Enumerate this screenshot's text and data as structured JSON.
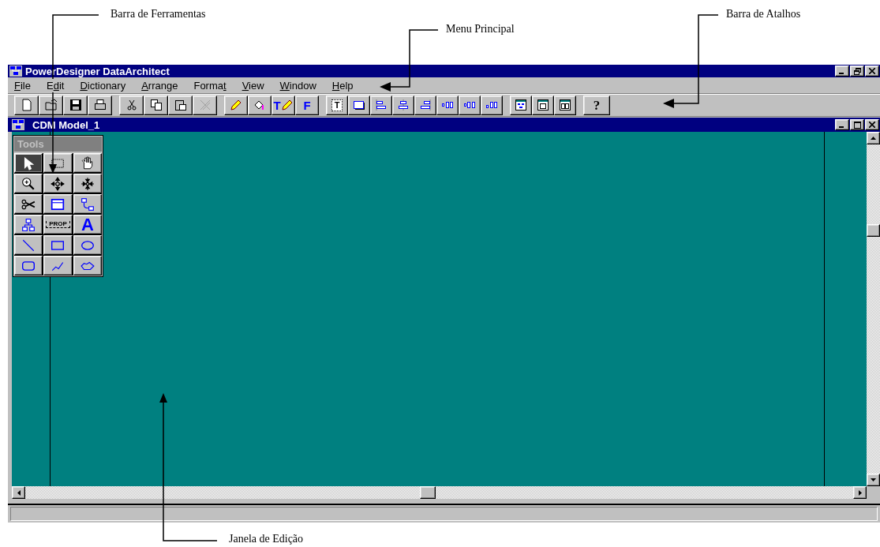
{
  "annotations": [
    {
      "text": "Barra de Ferramentas"
    },
    {
      "text": "Menu Principal"
    },
    {
      "text": "Barra de Atalhos"
    },
    {
      "text": "Janela de Edição"
    }
  ],
  "window": {
    "title": "PowerDesigner DataArchitect"
  },
  "menu": [
    {
      "key": "F",
      "rest": "ile"
    },
    {
      "before": "E",
      "key": "d",
      "rest": "it"
    },
    {
      "key": "D",
      "rest": "ictionary"
    },
    {
      "key": "A",
      "rest": "rrange"
    },
    {
      "before": "Forma",
      "key": "t"
    },
    {
      "key": "V",
      "rest": "iew"
    },
    {
      "key": "W",
      "rest": "indow"
    },
    {
      "key": "H",
      "rest": "elp"
    }
  ],
  "toolbar": [
    [
      {
        "disabled": false
      },
      {
        "disabled": false
      },
      {
        "disabled": false
      },
      {
        "disabled": false
      }
    ],
    [
      {
        "disabled": false
      },
      {
        "disabled": false
      },
      {
        "disabled": false
      },
      {
        "disabled": true
      }
    ],
    [
      {
        "disabled": false
      },
      {
        "disabled": false
      },
      {
        "disabled": false,
        "label": "T"
      },
      {
        "disabled": false,
        "label": "F"
      }
    ],
    [
      {
        "disabled": false,
        "label": "T"
      },
      {
        "disabled": false
      },
      {
        "disabled": false
      },
      {
        "disabled": false
      },
      {
        "disabled": false
      },
      {
        "disabled": false
      },
      {
        "disabled": false
      },
      {
        "disabled": false
      }
    ],
    [
      {
        "disabled": false
      },
      {
        "disabled": false
      },
      {
        "disabled": false
      }
    ],
    [
      {
        "disabled": false,
        "label": "?"
      }
    ]
  ],
  "document": {
    "title": "CDM Model_1"
  },
  "tools": {
    "title": "Tools",
    "items": [
      {
        "selected": true
      },
      {
        "selected": false
      },
      {
        "selected": false
      },
      {
        "selected": false
      },
      {
        "selected": false
      },
      {
        "selected": false
      },
      {
        "selected": false
      },
      {
        "selected": false
      },
      {
        "selected": false
      },
      {
        "selected": false
      },
      {
        "selected": false,
        "label": "PROP"
      },
      {
        "selected": false,
        "label": "A"
      },
      {
        "selected": false
      },
      {
        "selected": false
      },
      {
        "selected": false
      },
      {
        "selected": false
      },
      {
        "selected": false
      },
      {
        "selected": false
      }
    ]
  }
}
